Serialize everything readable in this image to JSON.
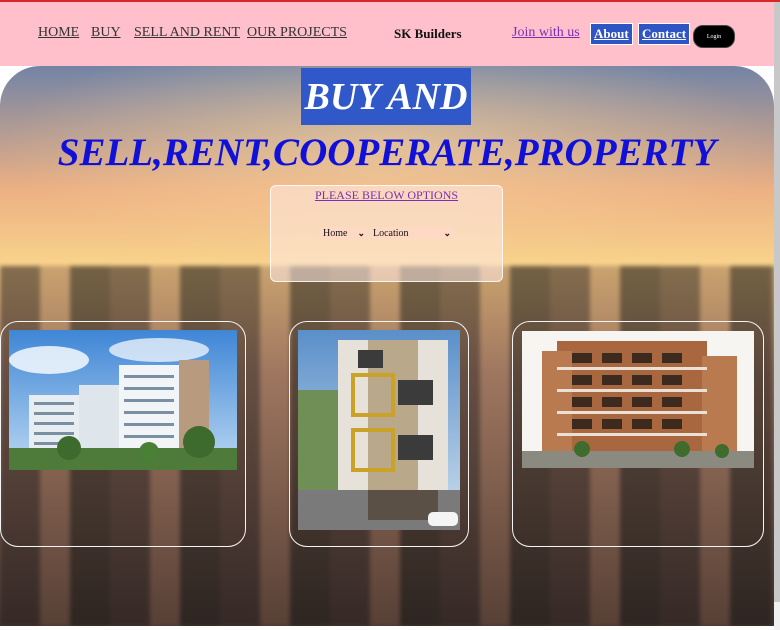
{
  "nav": {
    "links": [
      "HOME",
      "BUY",
      "SELL AND RENT",
      "OUR PROJECTS"
    ],
    "brand": "SK Builders",
    "join": "Join with us",
    "about": "About",
    "contact": "Contact",
    "login": "Login"
  },
  "hero": {
    "line1": "BUY AND",
    "line2": "SELL,RENT,COOPERATE,PROPERTY"
  },
  "options": {
    "title": "PLEASE BELOW OPTIONS",
    "select1": "Home",
    "select2": "Location"
  }
}
